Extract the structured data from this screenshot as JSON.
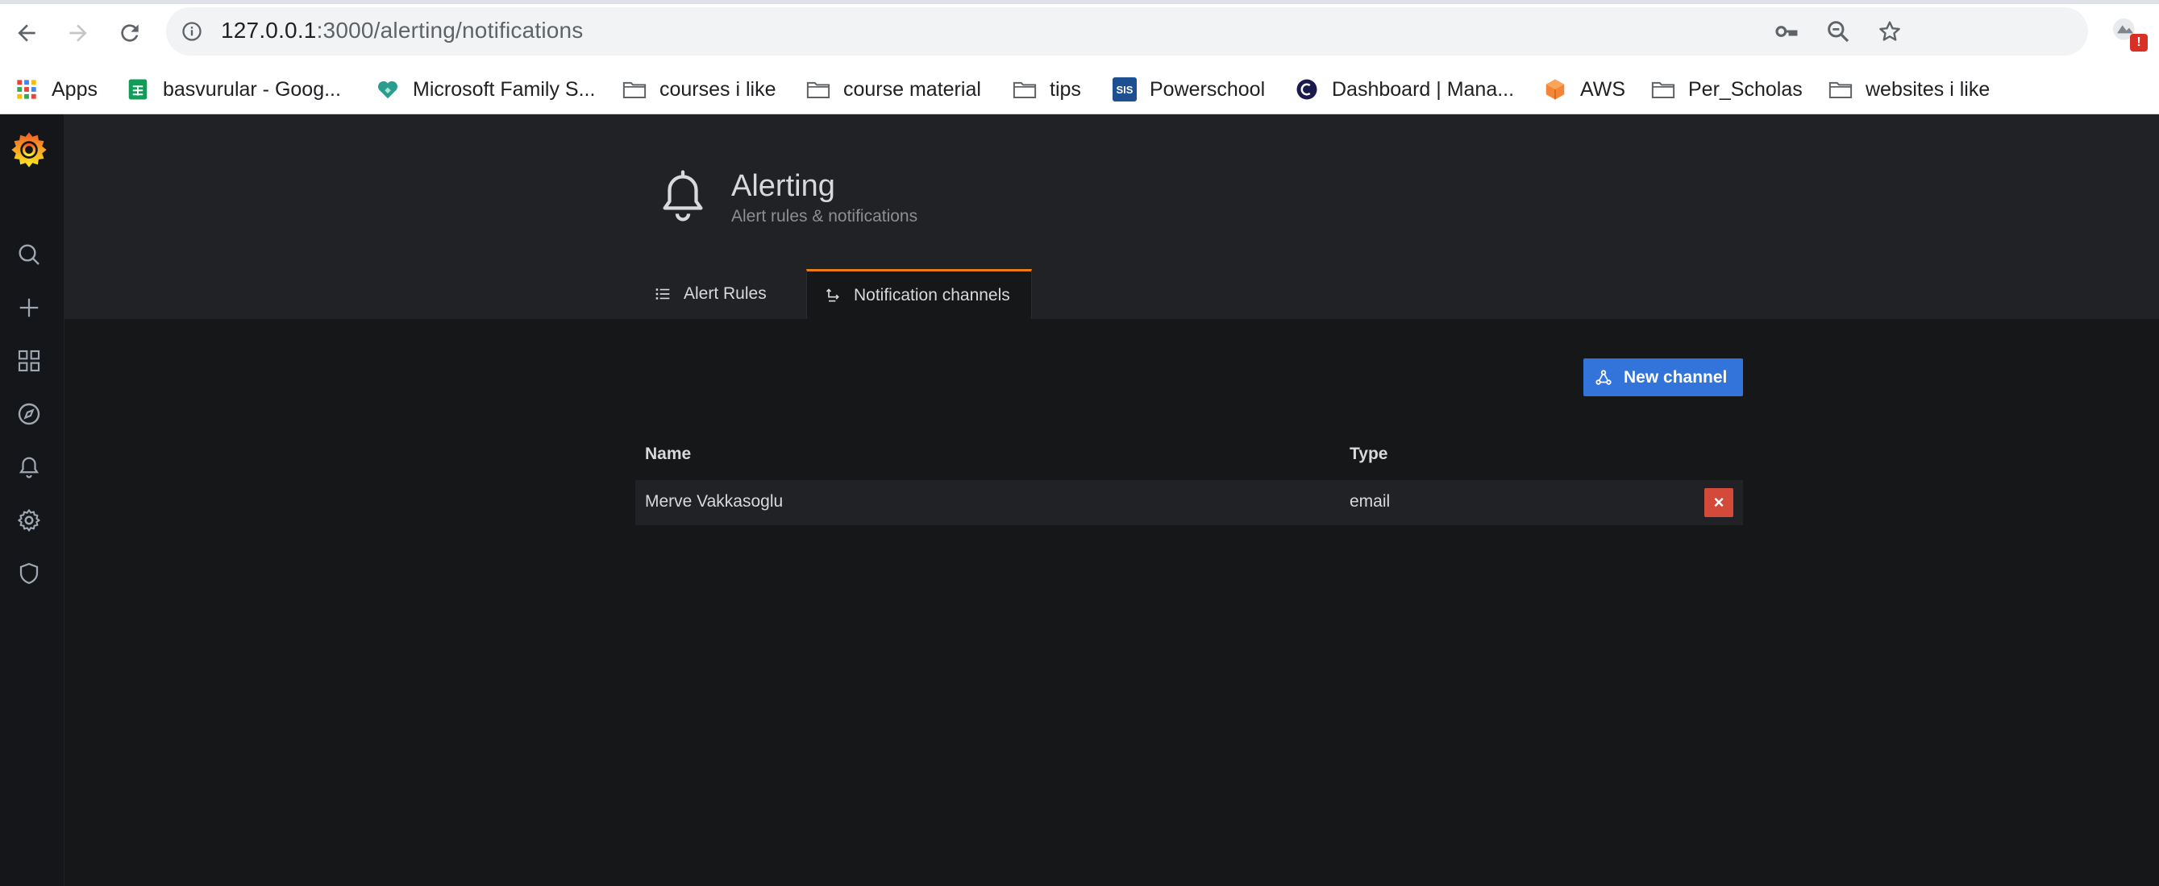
{
  "browser": {
    "url_host": "127.0.0.1",
    "url_rest": ":3000/alerting/notifications",
    "bookmarks": [
      {
        "label": "Apps",
        "icon": "apps-grid-icon"
      },
      {
        "label": "basvurular - Goog...",
        "icon": "google-sheets-icon"
      },
      {
        "label": "Microsoft Family S...",
        "icon": "microsoft-family-icon"
      },
      {
        "label": "courses i like",
        "icon": "folder-icon"
      },
      {
        "label": "course material",
        "icon": "folder-icon"
      },
      {
        "label": "tips",
        "icon": "folder-icon"
      },
      {
        "label": "Powerschool",
        "icon": "sis-icon",
        "icon_text": "SIS"
      },
      {
        "label": "Dashboard | Mana...",
        "icon": "dashboard-site-icon"
      },
      {
        "label": "AWS",
        "icon": "aws-icon"
      },
      {
        "label": "Per_Scholas",
        "icon": "folder-icon"
      },
      {
        "label": "websites i like",
        "icon": "folder-icon"
      }
    ],
    "profile_badge": "!"
  },
  "header": {
    "title": "Alerting",
    "subtitle": "Alert rules & notifications",
    "tabs": [
      {
        "label": "Alert Rules",
        "active": false
      },
      {
        "label": "Notification channels",
        "active": true
      }
    ]
  },
  "actions": {
    "new_channel_label": "New channel"
  },
  "table": {
    "columns": [
      "Name",
      "Type"
    ],
    "rows": [
      {
        "name": "Merve Vakkasoglu",
        "type": "email",
        "delete_label": "×"
      }
    ]
  },
  "colors": {
    "accent_orange": "#eb7b18",
    "primary_blue": "#3274d9",
    "danger_red": "#d44a3a",
    "panel_bg": "#212226",
    "page_bg": "#161719"
  }
}
